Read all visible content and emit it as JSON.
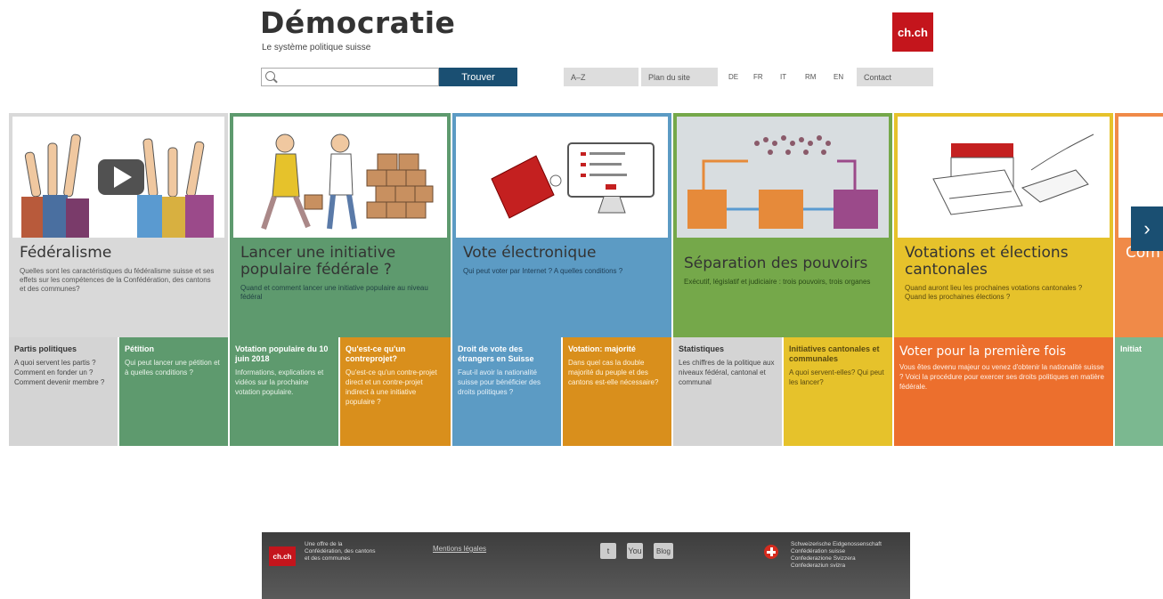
{
  "header": {
    "title": "Démocratie",
    "subtitle": "Le système politique suisse",
    "logo": "ch.ch",
    "search": {
      "placeholder": "",
      "button": "Trouver"
    },
    "tools": {
      "az": "A–Z",
      "sitemap": "Plan du site",
      "contact": "Contact"
    },
    "languages": [
      "DE",
      "FR",
      "IT",
      "RM",
      "EN"
    ]
  },
  "slides": [
    {
      "title": "Fédéralisme",
      "text": "Quelles sont les caractéristiques du fédéralisme suisse et ses effets sur les compétences de la Confédération, des cantons et des communes?",
      "color": "#d9d9d9"
    },
    {
      "title": "Lancer une initiative populaire fédérale ?",
      "text": "Quand et comment lancer une initiative populaire au niveau fédéral",
      "color": "#5e9a6e"
    },
    {
      "title": "Vote électronique",
      "text": "Qui peut voter par Internet ? A quelles conditions ?",
      "color": "#5c9bc4"
    },
    {
      "title": "Séparation des pouvoirs",
      "text": "Exécutif, législatif et judiciaire : trois pouvoirs, trois organes",
      "color": "#75a84a"
    },
    {
      "title": "Votations et élections cantonales",
      "text": "Quand auront lieu les prochaines votations cantonales ? Quand les prochaines élections ?",
      "color": "#e6c22b"
    },
    {
      "title": "Com",
      "text": "",
      "color": "#f08a48"
    }
  ],
  "tiles": [
    {
      "title": "Partis politiques",
      "text": "A quoi servent les partis ? Comment en fonder un ? Comment devenir membre ?",
      "color": "#d4d4d4"
    },
    {
      "title": "Pétition",
      "text": "Qui peut lancer une pétition et à quelles conditions ?",
      "color": "#5e9a6e"
    },
    {
      "title": "Votation populaire du 10 juin 2018",
      "text": "Informations, explications et vidéos sur la prochaine votation populaire.",
      "color": "#5e9a6e"
    },
    {
      "title": "Qu'est-ce qu'un contreprojet?",
      "text": "Qu'est-ce qu'un contre-projet direct et un contre-projet indirect à une initiative populaire ?",
      "color": "#d98f1c"
    },
    {
      "title": "Droit de vote des étrangers en Suisse",
      "text": "Faut-il avoir la nationalité suisse pour bénéficier des droits politiques ?",
      "color": "#5c9bc4"
    },
    {
      "title": "Votation: majorité",
      "text": "Dans quel cas la double majorité du peuple et des cantons est-elle nécessaire?",
      "color": "#d98f1c"
    },
    {
      "title": "Statistiques",
      "text": "Les chiffres de la politique aux niveaux fédéral, cantonal et communal",
      "color": "#d4d4d4"
    },
    {
      "title": "Initiatives cantonales et communales",
      "text": "A quoi servent-elles? Qui peut les lancer?",
      "color": "#e6c22b"
    },
    {
      "title": "Voter pour la première fois",
      "text": "Vous êtes devenu majeur ou venez d'obtenir la nationalité suisse ? Voici la procédure pour exercer ses droits politiques en matière fédérale.",
      "color": "#ec6f2d"
    },
    {
      "title": "Initiat",
      "text": "",
      "color": "#7bb890"
    }
  ],
  "footer": {
    "logo": "ch.ch",
    "offer": "Une offre de la Confédération, des cantons et des communes",
    "legal": "Mentions légales",
    "twitter": "t",
    "youtube": "You",
    "blog": "Blog",
    "confed": [
      "Schweizerische Eidgenossenschaft",
      "Confédération suisse",
      "Confederazione Svizzera",
      "Confederaziun svizra"
    ]
  }
}
